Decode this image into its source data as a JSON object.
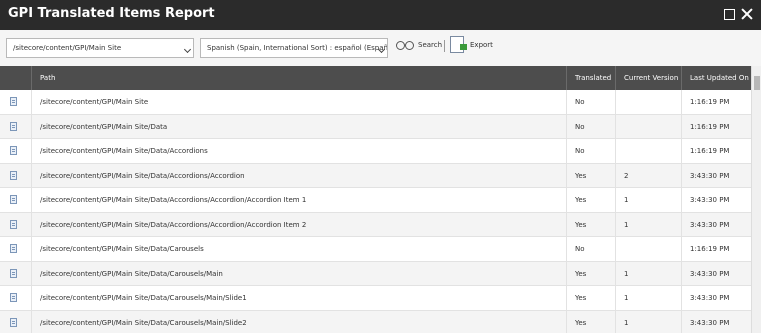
{
  "window": {
    "title": "GPI Translated Items Report"
  },
  "toolbar": {
    "path_select_value": "/sitecore/content/GPI/Main Site",
    "language_select_value": "Spanish (Spain, International Sort) : español (España, al",
    "search_label": "Search",
    "export_label": "Export"
  },
  "table": {
    "columns": [
      "Path",
      "Translated",
      "Current Version",
      "Last Updated On"
    ],
    "rows": [
      {
        "path": "/sitecore/content/GPI/Main Site",
        "translated": "No",
        "version": "",
        "updated": "1:16:19 PM"
      },
      {
        "path": "/sitecore/content/GPI/Main Site/Data",
        "translated": "No",
        "version": "",
        "updated": "1:16:19 PM"
      },
      {
        "path": "/sitecore/content/GPI/Main Site/Data/Accordions",
        "translated": "No",
        "version": "",
        "updated": "1:16:19 PM"
      },
      {
        "path": "/sitecore/content/GPI/Main Site/Data/Accordions/Accordion",
        "translated": "Yes",
        "version": "2",
        "updated": "3:43:30 PM"
      },
      {
        "path": "/sitecore/content/GPI/Main Site/Data/Accordions/Accordion/Accordion Item 1",
        "translated": "Yes",
        "version": "1",
        "updated": "3:43:30 PM"
      },
      {
        "path": "/sitecore/content/GPI/Main Site/Data/Accordions/Accordion/Accordion Item 2",
        "translated": "Yes",
        "version": "1",
        "updated": "3:43:30 PM"
      },
      {
        "path": "/sitecore/content/GPI/Main Site/Data/Carousels",
        "translated": "No",
        "version": "",
        "updated": "1:16:19 PM"
      },
      {
        "path": "/sitecore/content/GPI/Main Site/Data/Carousels/Main",
        "translated": "Yes",
        "version": "1",
        "updated": "3:43:30 PM"
      },
      {
        "path": "/sitecore/content/GPI/Main Site/Data/Carousels/Main/Slide1",
        "translated": "Yes",
        "version": "1",
        "updated": "3:43:30 PM"
      },
      {
        "path": "/sitecore/content/GPI/Main Site/Data/Carousels/Main/Slide2",
        "translated": "Yes",
        "version": "1",
        "updated": "3:43:30 PM"
      }
    ]
  },
  "icons": {
    "row_icon": "document-icon",
    "search": "binoculars-icon",
    "export": "excel-export-icon",
    "maximize": "maximize-icon",
    "close": "close-icon"
  }
}
